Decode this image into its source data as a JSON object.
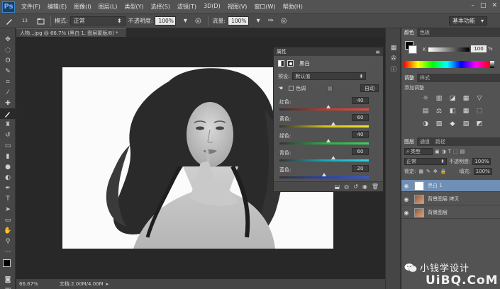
{
  "app": {
    "logo": "Ps"
  },
  "menu": [
    "文件(F)",
    "编辑(E)",
    "图像(I)",
    "图层(L)",
    "类型(Y)",
    "选择(S)",
    "滤镜(T)",
    "3D(D)",
    "视图(V)",
    "窗口(W)",
    "帮助(H)"
  ],
  "window_controls": [
    "–",
    "□",
    "✕"
  ],
  "options": {
    "size": "13",
    "mode_label": "模式:",
    "mode_value": "正常",
    "opacity_label": "不透明度:",
    "opacity_value": "100%",
    "flow_label": "流量:",
    "flow_value": "100%",
    "workspace": "基本功能"
  },
  "document": {
    "tab_title": "人物...jpg @ 66.7% (黑白 1, 图层蒙版/8) *",
    "zoom": "66.67%",
    "doc_info": "文档:2.00M/4.00M"
  },
  "properties": {
    "panel_title": "属性",
    "adjust_name": "黑白",
    "preset_label": "预设:",
    "preset_value": "默认值",
    "tint_label": "色调",
    "auto_label": "自动",
    "sliders": [
      {
        "label": "红色:",
        "value": "40",
        "pos": 0.55,
        "gradient": "linear-gradient(to right,#333,#c0392b,#e74c3c)"
      },
      {
        "label": "黄色:",
        "value": "60",
        "pos": 0.6,
        "gradient": "linear-gradient(to right,#333,#d4c21c,#f1e23a)"
      },
      {
        "label": "绿色:",
        "value": "40",
        "pos": 0.55,
        "gradient": "linear-gradient(to right,#333,#27ae40,#3ccf5c)"
      },
      {
        "label": "青色:",
        "value": "60",
        "pos": 0.6,
        "gradient": "linear-gradient(to right,#333,#16a8b5,#2bd5e3)"
      },
      {
        "label": "蓝色:",
        "value": "20",
        "pos": 0.5,
        "gradient": "linear-gradient(to right,#333,#2640b5,#3358e6)"
      }
    ]
  },
  "color_panel": {
    "tabs": [
      "颜色",
      "色板"
    ],
    "k_label": "K",
    "k_value": "100",
    "pct": "%"
  },
  "adjust_panel": {
    "tabs": [
      "调整",
      "样式"
    ],
    "add_label": "添加调整"
  },
  "layers_panel": {
    "tabs": [
      "图层",
      "通道",
      "路径"
    ],
    "kind_label": "类型",
    "blend_value": "正常",
    "opacity_label": "不透明度:",
    "opacity_value": "100%",
    "lock_label": "锁定:",
    "fill_label": "填充:",
    "fill_value": "100%",
    "layers": [
      {
        "name": "黑白 1",
        "selected": true
      },
      {
        "name": "背景图层 拷贝",
        "selected": false
      },
      {
        "name": "背景图层",
        "selected": false
      }
    ]
  },
  "watermark": {
    "text1": "小钱学设计",
    "text2": "UiBQ.CoM"
  },
  "colors": {
    "selected_layer": "#6f8fb6",
    "accent": "#3b82c8"
  }
}
